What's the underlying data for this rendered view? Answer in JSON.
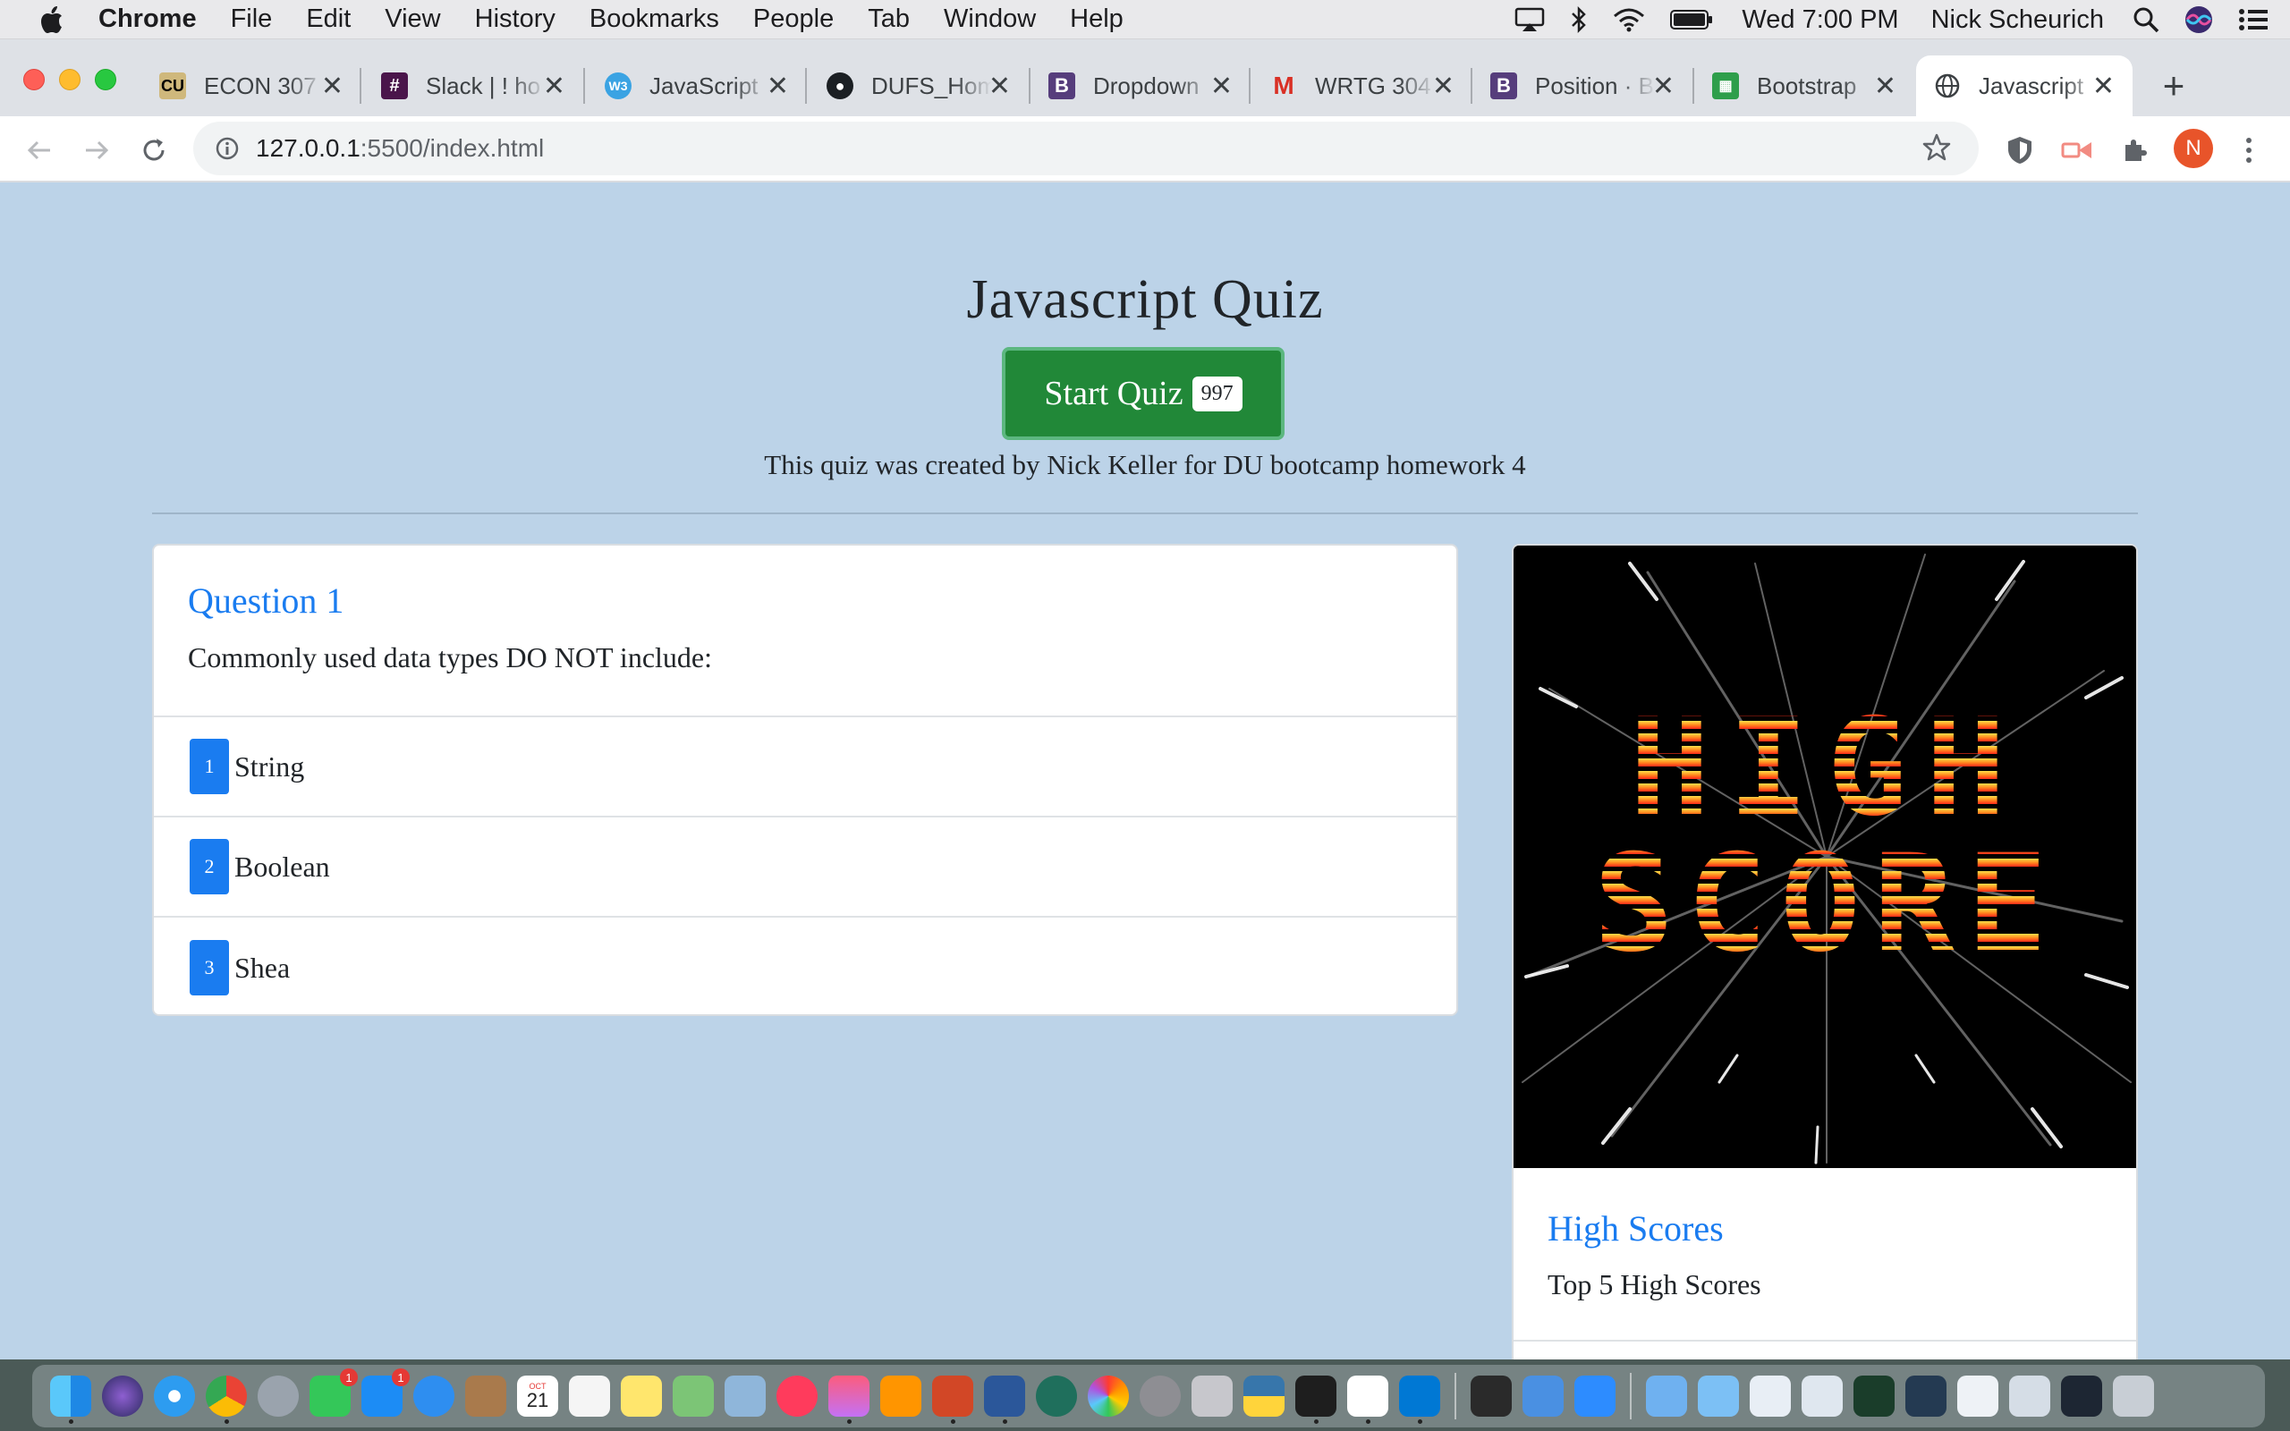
{
  "menubar": {
    "app": "Chrome",
    "items": [
      "File",
      "Edit",
      "View",
      "History",
      "Bookmarks",
      "People",
      "Tab",
      "Window",
      "Help"
    ],
    "clock": "Wed 7:00 PM",
    "user": "Nick Scheurich"
  },
  "tabs": [
    {
      "title": "ECON 307",
      "favicon": "cu-icon"
    },
    {
      "title": "Slack | ! ho",
      "favicon": "slack-icon"
    },
    {
      "title": "JavaScript",
      "favicon": "w3-icon"
    },
    {
      "title": "DUFS_Hom",
      "favicon": "github-icon"
    },
    {
      "title": "Dropdown",
      "favicon": "bootstrap-icon"
    },
    {
      "title": "WRTG 304",
      "favicon": "gmail-icon"
    },
    {
      "title": "Position · B",
      "favicon": "bootstrap-icon"
    },
    {
      "title": "Bootstrap",
      "favicon": "sheets-icon"
    },
    {
      "title": "Javascript",
      "favicon": "globe-icon",
      "active": true
    }
  ],
  "omnibox": {
    "host": "127.0.0.1",
    "path": ":5500/index.html"
  },
  "profile_initial": "N",
  "page": {
    "title": "Javascript Quiz",
    "start_label": "Start Quiz",
    "timer": "997",
    "credit": "This quiz was created by Nick Keller for DU bootcamp homework 4",
    "question": {
      "title": "Question 1",
      "text": "Commonly used data types DO NOT include:",
      "answers": [
        {
          "num": "1",
          "label": "String"
        },
        {
          "num": "2",
          "label": "Boolean"
        },
        {
          "num": "3",
          "label": "Shea"
        }
      ]
    },
    "highscores": {
      "image_text_top": "HIGH",
      "image_text_bottom": "SCORE",
      "title": "High Scores",
      "subtitle": "Top 5 High Scores"
    }
  },
  "dock": {
    "badges": {
      "facetime": "1",
      "appstore": "1"
    },
    "calendar_month": "OCT",
    "calendar_day": "21"
  },
  "colors": {
    "page_bg": "#bcd3e8",
    "accent": "#1a7cf0",
    "start_btn": "#218838"
  }
}
